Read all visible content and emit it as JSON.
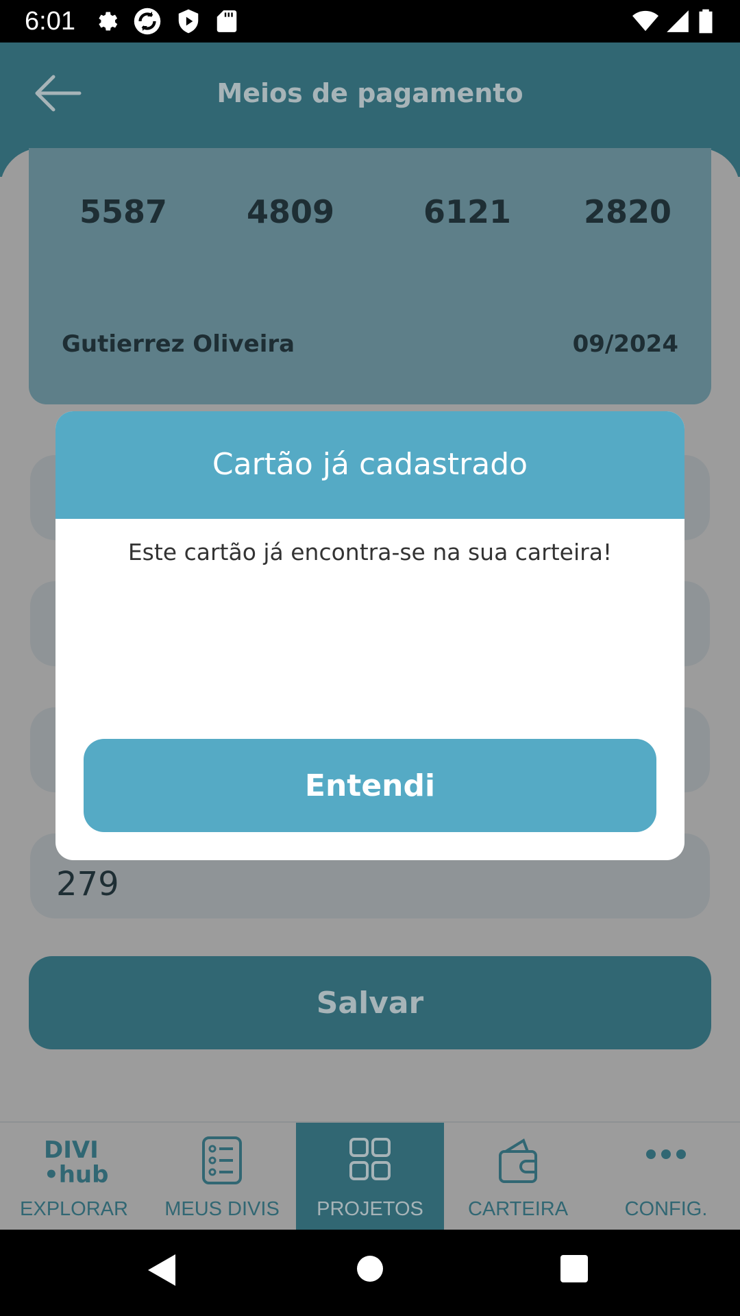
{
  "status_bar": {
    "time": "6:01",
    "icons": [
      "gear-icon",
      "sync-icon",
      "shield-icon",
      "sd-card-icon",
      "wifi-icon",
      "signal-icon",
      "battery-icon"
    ]
  },
  "app_bar": {
    "title": "Meios de pagamento",
    "back_icon": "arrow-left-icon"
  },
  "card": {
    "number_groups": [
      "5587",
      "4809",
      "6121",
      "2820"
    ],
    "holder": "Gutierrez Oliveira",
    "expiry": "09/2024"
  },
  "form": {
    "cvv_value": "279",
    "save_label": "Salvar"
  },
  "bottom_nav": {
    "items": [
      {
        "label": "EXPLORAR",
        "icon": "divi-hub-logo",
        "logo_line1": "DIVI",
        "logo_line2": "•hub"
      },
      {
        "label": "MEUS DIVIS",
        "icon": "list-icon"
      },
      {
        "label": "PROJETOS",
        "icon": "grid-icon",
        "active": true
      },
      {
        "label": "CARTEIRA",
        "icon": "wallet-icon"
      },
      {
        "label": "CONFIG.",
        "icon": "more-dots-icon"
      }
    ]
  },
  "dialog": {
    "title": "Cartão já cadastrado",
    "message": "Este cartão já encontra-se na sua carteira!",
    "button_label": "Entendi"
  },
  "colors": {
    "primary": "#316773",
    "accent": "#55aac5",
    "overlay": "#9c9c9c"
  }
}
